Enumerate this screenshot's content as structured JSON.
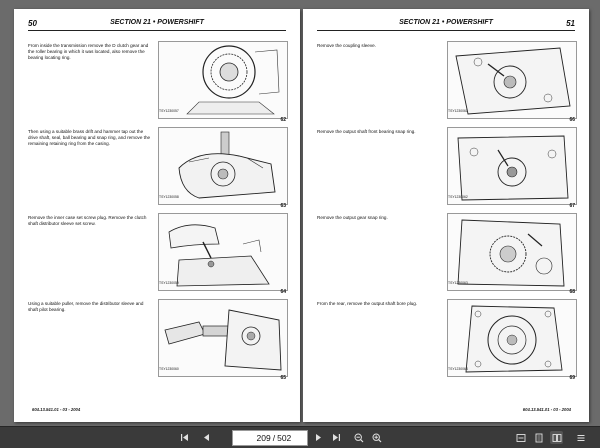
{
  "left_page": {
    "page_number": "50",
    "section": "SECTION 21 •  POWERSHIFT",
    "footer": "604.13.541.01 - 03 - 2004",
    "steps": [
      {
        "text": "From inside the transmission remove the D clutch gear and the roller bearing in which it was located, also remove the bearing locating ring.",
        "code": "TSY1230057",
        "figure": "62"
      },
      {
        "text": "Then using a suitable brass drift and hammer tap out the drive shaft, seal, ball bearing and snap ring, and remove the remaining retaining ring from the casing.",
        "code": "TSY1230058",
        "figure": "63"
      },
      {
        "text": "Remove the inner case set screw plug. Remove the clutch shaft distributor sleeve set screw.",
        "code": "TSY1230059",
        "figure": "64"
      },
      {
        "text": "Using a suitable puller, remove the distributor sleeve and shaft pilot bearing.",
        "code": "TSY1230060",
        "figure": "65"
      }
    ]
  },
  "right_page": {
    "page_number": "51",
    "section": "SECTION 21 •  POWERSHIFT",
    "footer": "604.13.541.01 - 03 - 2004",
    "steps": [
      {
        "text": "Remove the coupling sleeve.",
        "code": "TSY1230061",
        "figure": "66"
      },
      {
        "text": "Remove the output shaft front bearing snap ring.",
        "code": "TSY1230062",
        "figure": "67"
      },
      {
        "text": "Remove the output gear snap ring.",
        "code": "TSY1230063",
        "figure": "68"
      },
      {
        "text": "From the rear, remove the output shaft bore plug.",
        "code": "TSY1230064",
        "figure": "69"
      }
    ]
  },
  "toolbar": {
    "current_page": "209",
    "separator": "/",
    "total_pages": "502"
  },
  "icons": {
    "first": "first-page-icon",
    "prev": "previous-page-icon",
    "next": "next-page-icon",
    "last": "last-page-icon",
    "zoom_out": "zoom-out-icon",
    "zoom_in": "zoom-in-icon",
    "fit_width": "fit-width-icon",
    "fit_page": "fit-page-icon",
    "single_page": "single-page-icon",
    "menu": "menu-icon"
  }
}
